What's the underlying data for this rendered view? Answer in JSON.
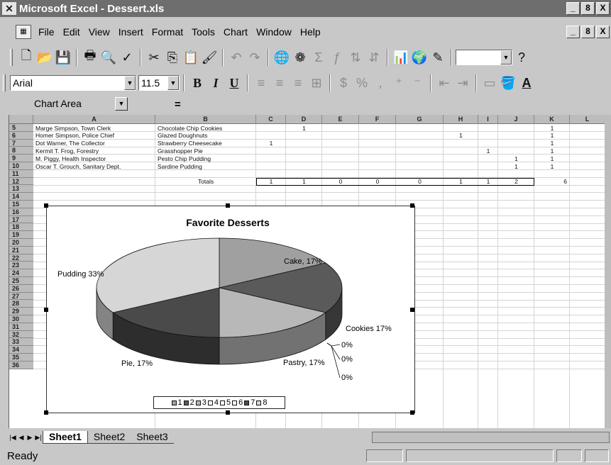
{
  "window": {
    "title": "Microsoft Excel - Dessert.xls",
    "buttons": [
      "_",
      "8",
      "X"
    ]
  },
  "menu": {
    "items": [
      "File",
      "Edit",
      "View",
      "Insert",
      "Format",
      "Tools",
      "Chart",
      "Window",
      "Help"
    ]
  },
  "toolbar": {
    "font_name": "Arial",
    "font_size": "11.5",
    "bold_label": "B",
    "italic_label": "I",
    "underline_label": "U"
  },
  "formula_bar": {
    "name_box": "Chart Area",
    "equals": "="
  },
  "grid": {
    "columns": [
      "A",
      "B",
      "C",
      "D",
      "E",
      "F",
      "G",
      "H",
      "I",
      "J",
      "K",
      "L"
    ],
    "row_numbers": [
      "5",
      "6",
      "7",
      "8",
      "9",
      "10",
      "11",
      "12",
      "13",
      "14",
      "15",
      "16",
      "17",
      "18",
      "19",
      "20",
      "21",
      "22",
      "23",
      "24",
      "25",
      "26",
      "27",
      "28",
      "29",
      "30",
      "31",
      "32",
      "33",
      "34",
      "35",
      "36"
    ],
    "data_rows": [
      {
        "row": "5",
        "name": "Marge Simpson, Town Clerk",
        "dessert": "Chocolate Chip Cookies",
        "marks": {
          "D": "1",
          "K": "1"
        }
      },
      {
        "row": "6",
        "name": "Homer Simpson, Police Chief",
        "dessert": "Glazed Doughnuts",
        "marks": {
          "H": "1",
          "K": "1"
        }
      },
      {
        "row": "7",
        "name": "Dot Warner, The Collector",
        "dessert": "Strawberry Cheesecake",
        "marks": {
          "C": "1",
          "K": "1"
        }
      },
      {
        "row": "8",
        "name": "Kermit T. Frog, Forestry",
        "dessert": "Grasshopper Pie",
        "marks": {
          "I": "1",
          "K": "1"
        }
      },
      {
        "row": "9",
        "name": "M. Piggy, Health Inspector",
        "dessert": "Pesto Chip Pudding",
        "marks": {
          "J": "1",
          "K": "1"
        }
      },
      {
        "row": "10",
        "name": "Oscar T. Grouch, Sanitary Dept.",
        "dessert": "Sardine Pudding",
        "marks": {
          "J": "1",
          "K": "1"
        }
      }
    ],
    "totals_label": "Totals",
    "totals": {
      "C": "1",
      "D": "1",
      "E": "0",
      "F": "0",
      "G": "0",
      "H": "1",
      "I": "1",
      "J": "2",
      "K": "6"
    }
  },
  "chart_data": {
    "type": "pie",
    "title": "Favorite Desserts",
    "categories": [
      "Cake",
      "Cookies",
      "Pastry",
      "0%",
      "0%",
      "0%",
      "Pie",
      "Pudding"
    ],
    "slices": [
      {
        "label": "Cake, 17%",
        "value": 1,
        "color": "#a0a0a0"
      },
      {
        "label": "Cookies 17%",
        "value": 1,
        "color": "#5a5a5a"
      },
      {
        "label": "Pastry, 17%",
        "value": 1,
        "color": "#b8b8b8"
      },
      {
        "label": "0%",
        "value": 0,
        "color": "#ffffff"
      },
      {
        "label": "0%",
        "value": 0,
        "color": "#ffffff"
      },
      {
        "label": "0%",
        "value": 0,
        "color": "#ffffff"
      },
      {
        "label": "Pie, 17%",
        "value": 1,
        "color": "#4a4a4a"
      },
      {
        "label": "Pudding 33%",
        "value": 2,
        "color": "#d6d6d6"
      }
    ],
    "legend": [
      "1",
      "2",
      "3",
      "4",
      "5",
      "6",
      "7",
      "8"
    ],
    "legend_position": "bottom"
  },
  "sheets": {
    "tabs": [
      "Sheet1",
      "Sheet2",
      "Sheet3"
    ],
    "active": "Sheet1"
  },
  "status": {
    "text": "Ready"
  }
}
